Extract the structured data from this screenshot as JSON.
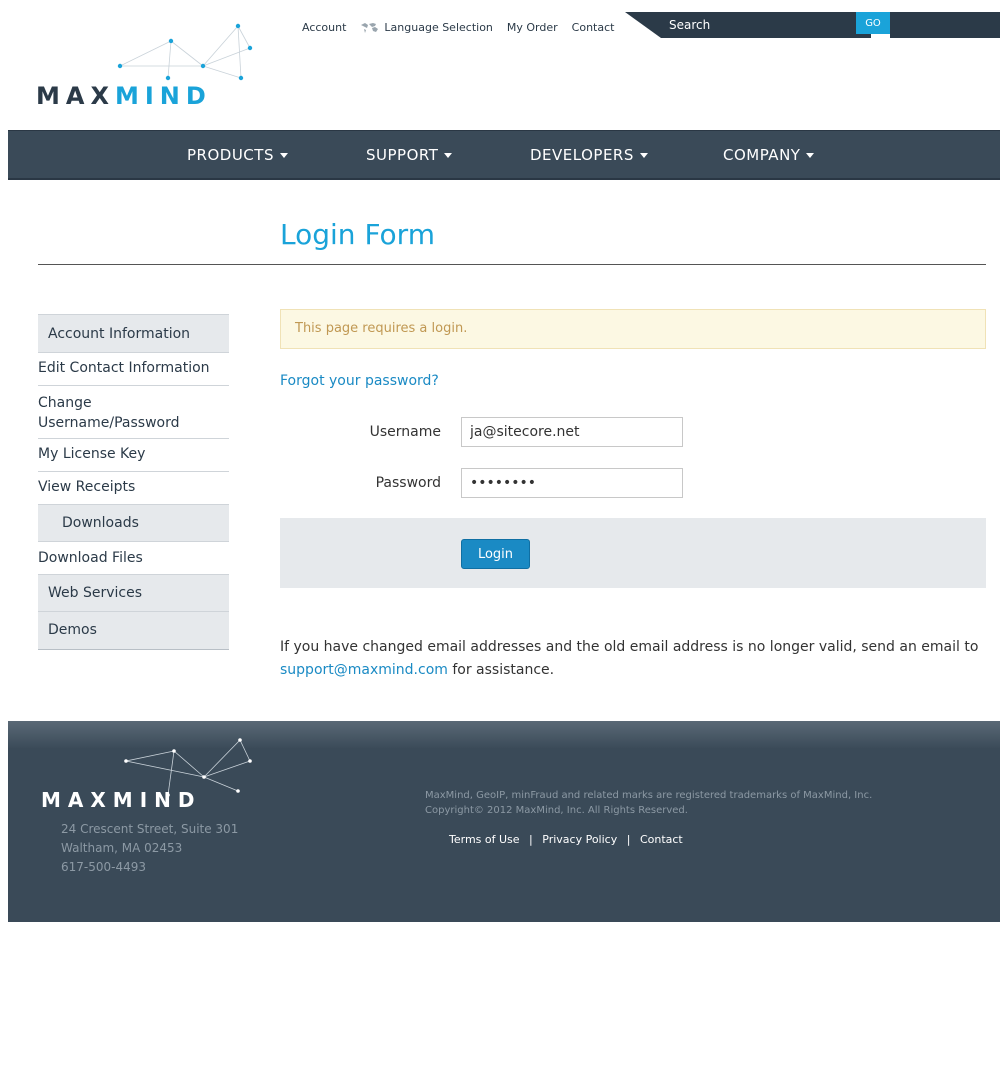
{
  "header": {
    "logo": {
      "part1": "MAX",
      "part2": "MIND"
    },
    "top_links": [
      "Account",
      "Language Selection",
      "My Order",
      "Contact"
    ],
    "search": {
      "placeholder": "Search",
      "go_label": "GO"
    }
  },
  "nav": {
    "items": [
      "PRODUCTS",
      "SUPPORT",
      "DEVELOPERS",
      "COMPANY"
    ]
  },
  "main": {
    "title": "Login Form",
    "alert": "This page requires a login.",
    "forgot": "Forgot your password?",
    "username_label": "Username",
    "username_value": "ja@sitecore.net",
    "password_label": "Password",
    "password_value": "password",
    "login_label": "Login",
    "note_text": "If you have changed email addresses and the old email address is no longer valid, send an email to",
    "note_email": "support@maxmind.com",
    "note_tail": "for assistance."
  },
  "sidebar": {
    "items": [
      {
        "label": "Account Information"
      },
      {
        "label": "Edit Contact Information"
      },
      {
        "label": "Change Username/Password"
      },
      {
        "label": "My License Key"
      },
      {
        "label": "View Receipts"
      },
      {
        "label": "Downloads"
      },
      {
        "label": "Download Files"
      },
      {
        "label": "Web Services"
      },
      {
        "label": "Demos"
      }
    ]
  },
  "footer": {
    "logo": "MAXMIND",
    "address": [
      "24 Crescent Street, Suite 301",
      "Waltham, MA 02453",
      "617-500-4493"
    ],
    "legal": [
      "MaxMind, GeoIP, minFraud and related marks are registered trademarks of MaxMind, Inc.",
      "Copyright© 2012 MaxMind, Inc. All Rights Reserved."
    ],
    "links": [
      "Terms of Use",
      "Privacy Policy",
      "Contact"
    ]
  },
  "colors": {
    "accent": "#1aa3d9",
    "dark": "#3a4a58",
    "link": "#1a8ac4"
  }
}
